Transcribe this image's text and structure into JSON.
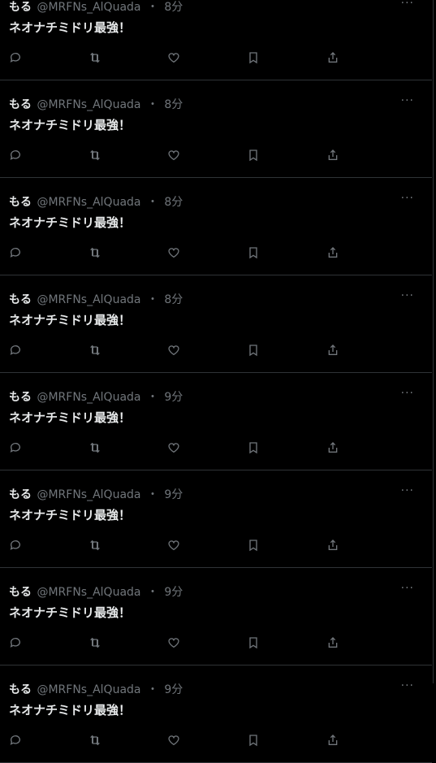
{
  "posts": [
    {
      "name": "もる",
      "handle": "@MRFNs_AlQuada",
      "time": "8分",
      "text": "ネオナチミドリ最強！"
    },
    {
      "name": "もる",
      "handle": "@MRFNs_AlQuada",
      "time": "8分",
      "text": "ネオナチミドリ最強！"
    },
    {
      "name": "もる",
      "handle": "@MRFNs_AlQuada",
      "time": "8分",
      "text": "ネオナチミドリ最強！"
    },
    {
      "name": "もる",
      "handle": "@MRFNs_AlQuada",
      "time": "8分",
      "text": "ネオナチミドリ最強！"
    },
    {
      "name": "もる",
      "handle": "@MRFNs_AlQuada",
      "time": "9分",
      "text": "ネオナチミドリ最強！"
    },
    {
      "name": "もる",
      "handle": "@MRFNs_AlQuada",
      "time": "9分",
      "text": "ネオナチミドリ最強！"
    },
    {
      "name": "もる",
      "handle": "@MRFNs_AlQuada",
      "time": "9分",
      "text": "ネオナチミドリ最強！"
    },
    {
      "name": "もる",
      "handle": "@MRFNs_AlQuada",
      "time": "9分",
      "text": "ネオナチミドリ最強！"
    }
  ],
  "separator": "・",
  "more_label": "···",
  "colors": {
    "background": "#000000",
    "text": "#e7e9ea",
    "muted": "#71767b",
    "border": "#2f3336"
  },
  "icons": [
    "reply-icon",
    "retweet-icon",
    "like-icon",
    "bookmark-icon",
    "share-icon"
  ]
}
